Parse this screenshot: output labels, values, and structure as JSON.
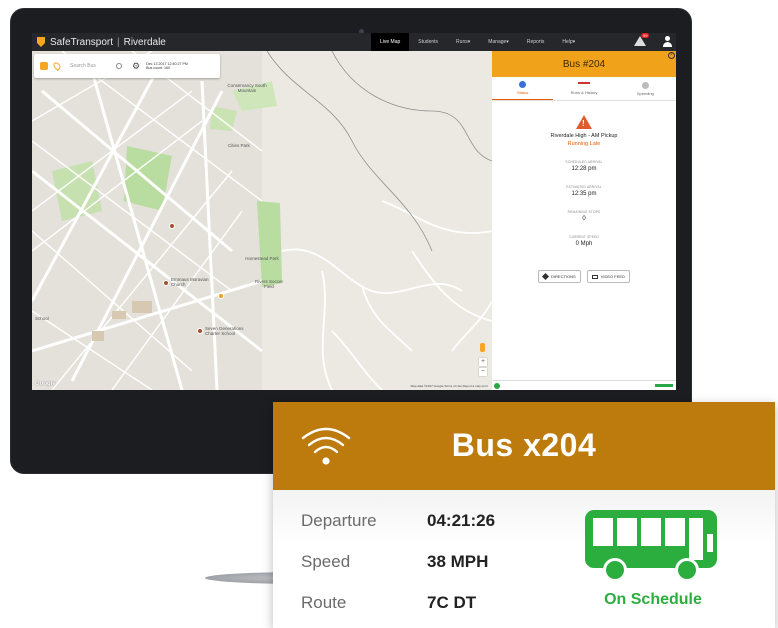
{
  "app": {
    "brand_name": "SafeTransport",
    "district": "Riverdale"
  },
  "nav": {
    "items": [
      "Live Map",
      "Students",
      "Runs▾",
      "Manage▾",
      "Reports",
      "Help▾"
    ],
    "notification_count": "99"
  },
  "map": {
    "search_placeholder": "Search Bus",
    "datetime": "Dec 13 2017 12:40:27 PM",
    "bus_count": "Bus count: 160",
    "labels": {
      "conservancy": "Conservancy South Mountain",
      "cities_park": "Cities Park",
      "homestead": "Homestead Park",
      "rivers": "Rivers Soccer Field",
      "emmaus": "Emmaus Moravian Church",
      "seven_gen": "Seven Generations Charter School",
      "school": "School"
    },
    "google": "Google",
    "terms": "Map data ©2017 Google   Terms of Use   Report a map error"
  },
  "panel": {
    "title": "Bus #204",
    "tabs": [
      "Status",
      "Runs & History",
      "Speeding"
    ],
    "route_name": "Riverdale High - AM Pickup",
    "status": "Running Late",
    "blocks": [
      {
        "label": "SCHEDULED ARRIVAL",
        "value": "12:28 pm"
      },
      {
        "label": "ESTIMATED ARRIVAL",
        "value": "12:35 pm"
      },
      {
        "label": "REMAINING STOPS",
        "value": "0"
      },
      {
        "label": "CURRENT SPEED",
        "value": "0 Mph"
      }
    ],
    "buttons": {
      "directions": "DIRECTIONS",
      "video": "VIDEO FEED"
    }
  },
  "card": {
    "title": "Bus x204",
    "rows": [
      {
        "label": "Departure",
        "value": "04:21:26"
      },
      {
        "label": "Speed",
        "value": "38 MPH"
      },
      {
        "label": "Route",
        "value": "7C DT"
      }
    ],
    "status": "On Schedule",
    "colors": {
      "header": "#bd7a0d",
      "ok": "#2cae3f"
    }
  }
}
